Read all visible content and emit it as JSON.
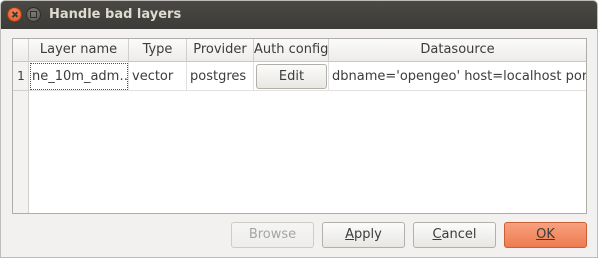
{
  "window": {
    "title": "Handle bad layers"
  },
  "table": {
    "columns": [
      "Layer name",
      "Type",
      "Provider",
      "Auth config",
      "Datasource"
    ],
    "rows": [
      {
        "row_number": "1",
        "layer_name": "ne_10m_adm…",
        "type": "vector",
        "provider": "postgres",
        "auth_config": "Edit",
        "datasource": "dbname='opengeo' host=localhost port=…"
      }
    ]
  },
  "buttons": {
    "browse": "Browse",
    "apply": "Apply",
    "cancel": "Cancel",
    "ok": "OK"
  }
}
